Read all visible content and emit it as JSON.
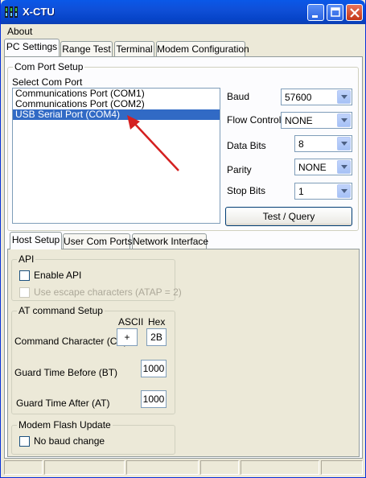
{
  "window": {
    "title": "X-CTU",
    "colors": {
      "titlebar": "#0a58e8",
      "selection": "#316ac5",
      "arrow": "#d42020"
    }
  },
  "menubar": {
    "items": [
      {
        "label": "About"
      }
    ]
  },
  "main_tabs": [
    {
      "label": "PC Settings",
      "active": true
    },
    {
      "label": "Range Test",
      "active": false
    },
    {
      "label": "Terminal",
      "active": false
    },
    {
      "label": "Modem Configuration",
      "active": false
    }
  ],
  "com_port_setup": {
    "title": "Com Port Setup",
    "select_label": "Select Com Port",
    "ports": [
      {
        "label": "Communications Port (COM1)",
        "selected": false
      },
      {
        "label": "Communications Port (COM2)",
        "selected": false
      },
      {
        "label": "USB Serial Port (COM4)",
        "selected": true
      }
    ],
    "settings": {
      "baud": {
        "label": "Baud",
        "value": "57600"
      },
      "flow_control": {
        "label": "Flow Control",
        "value": "NONE"
      },
      "data_bits": {
        "label": "Data Bits",
        "value": "8"
      },
      "parity": {
        "label": "Parity",
        "value": "NONE"
      },
      "stop_bits": {
        "label": "Stop Bits",
        "value": "1"
      }
    },
    "test_query_label": "Test  / Query"
  },
  "sub_tabs": [
    {
      "label": "Host Setup",
      "active": true
    },
    {
      "label": "User Com Ports",
      "active": false
    },
    {
      "label": "Network Interface",
      "active": false
    }
  ],
  "api": {
    "title": "API",
    "enable_api": {
      "label": "Enable API",
      "checked": false
    },
    "escape_chars": {
      "label": "Use escape characters (ATAP = 2)",
      "checked": false,
      "disabled": true
    }
  },
  "at_command": {
    "title": "AT command Setup",
    "ascii_header": "ASCII",
    "hex_header": "Hex",
    "command_char": {
      "label": "Command Character (CC)",
      "ascii": "+",
      "hex": "2B"
    },
    "guard_before": {
      "label": "Guard Time Before (BT)",
      "value": "1000"
    },
    "guard_after": {
      "label": "Guard Time After (AT)",
      "value": "1000"
    }
  },
  "modem_flash": {
    "title": "Modem Flash Update",
    "no_baud_change": {
      "label": "No baud change",
      "checked": false
    }
  },
  "statusbar": {
    "panes": [
      "",
      "",
      "",
      "",
      "",
      ""
    ]
  }
}
